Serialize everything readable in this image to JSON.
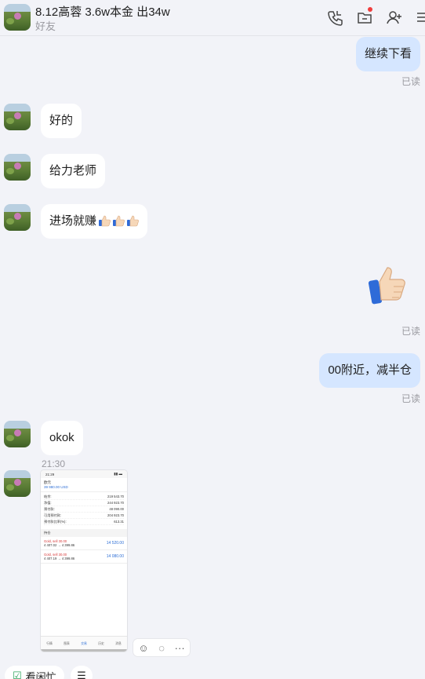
{
  "header": {
    "title": "8.12高蓉 3.6w本金 出34w",
    "subtitle": "好友",
    "icons": [
      "phone-icon",
      "folder-icon",
      "add-user-icon",
      "more-icon"
    ]
  },
  "messages": {
    "m1": "继续下看",
    "read1": "已读",
    "m2": "好的",
    "m3": "给力老师",
    "m4": "进场就赚",
    "m5_emoji": "👍",
    "read2": "已读",
    "m6": "00附近，减半仓",
    "read3": "已读",
    "m7": "okok",
    "time": "21:30"
  },
  "shot": {
    "status_time": "21:29",
    "acct_label": "欧元",
    "acct_value": "39 980.00 USD",
    "rows": [
      {
        "k": "结余:",
        "v": "219 543.70"
      },
      {
        "k": "净值:",
        "v": "244 923.70"
      },
      {
        "k": "预付款:",
        "v": "48 090.00"
      },
      {
        "k": "可用预付款:",
        "v": "204 923.70"
      },
      {
        "k": "预付款比率(%):",
        "v": "613.31"
      }
    ],
    "section": "持仓",
    "positions": [
      {
        "name": "Gold, sell 30.00",
        "detail": "4 407.02 → 4 399.86",
        "amount": "14 520.00"
      },
      {
        "name": "Gold, sell 30.00",
        "detail": "4 407.19 → 4 399.86",
        "amount": "14 080.00"
      }
    ],
    "tabs": [
      "行情",
      "图表",
      "交易",
      "历史",
      "消息"
    ]
  },
  "bottom": {
    "pill1": "看闲忙",
    "pill2": "☰"
  }
}
